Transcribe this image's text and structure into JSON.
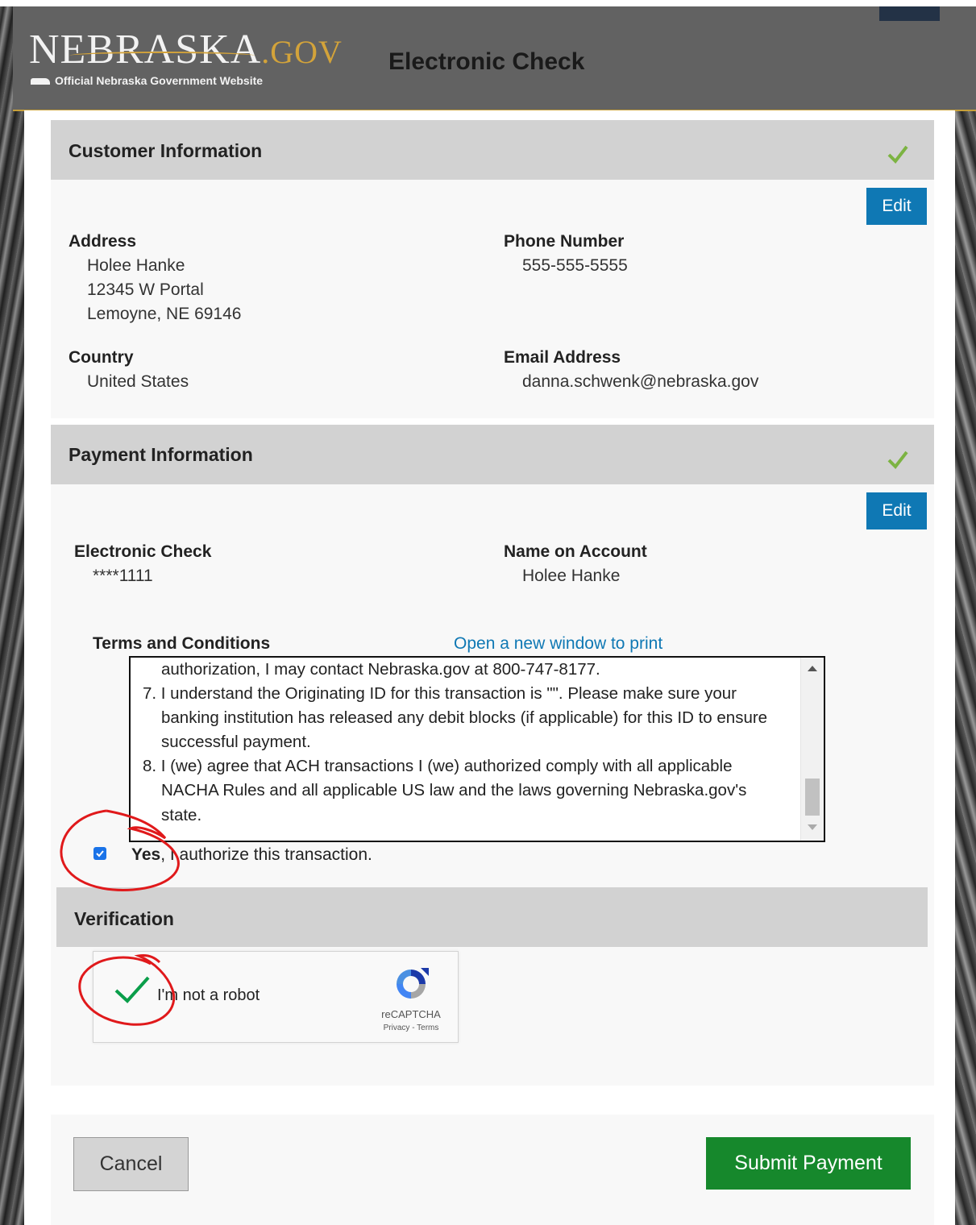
{
  "header": {
    "logo_main": "NEBRASKA",
    "logo_gov": ".GOV",
    "logo_sub": "Official Nebraska Government Website",
    "title": "Electronic Check"
  },
  "customer": {
    "heading": "Customer Information",
    "edit_label": "Edit",
    "address_label": "Address",
    "address_lines": [
      "Holee Hanke",
      "12345 W Portal",
      "Lemoyne, NE 69146"
    ],
    "phone_label": "Phone Number",
    "phone": "555-555-5555",
    "country_label": "Country",
    "country": "United States",
    "email_label": "Email Address",
    "email": "danna.schwenk@nebraska.gov"
  },
  "payment": {
    "heading": "Payment Information",
    "edit_label": "Edit",
    "method_label": "Electronic Check",
    "account_mask": "****1111",
    "name_label": "Name on Account",
    "name": "Holee Hanke"
  },
  "terms": {
    "label": "Terms and Conditions",
    "print_link": "Open a new window to print",
    "lines": [
      "authorization, I may contact Nebraska.gov at 800-747-8177.",
      "7. I understand the Originating ID for this transaction is \"\". Please make sure your",
      "banking institution has released any debit blocks (if applicable) for this ID to ensure",
      "successful payment.",
      "8. I (we) agree that ACH transactions I (we) authorized comply with all applicable",
      "NACHA Rules and all applicable US law and the laws governing Nebraska.gov's",
      "state."
    ],
    "authorize_bold": "Yes",
    "authorize_rest": ", I authorize this transaction."
  },
  "verification": {
    "heading": "Verification",
    "captcha_label": "I'm not a robot",
    "captcha_brand": "reCAPTCHA",
    "captcha_links": "Privacy - Terms"
  },
  "actions": {
    "cancel": "Cancel",
    "submit": "Submit Payment"
  },
  "colors": {
    "accent_blue": "#0f78b4",
    "submit_green": "#16882c",
    "check_green": "#7cb342",
    "annotation_red": "#e0191b"
  }
}
